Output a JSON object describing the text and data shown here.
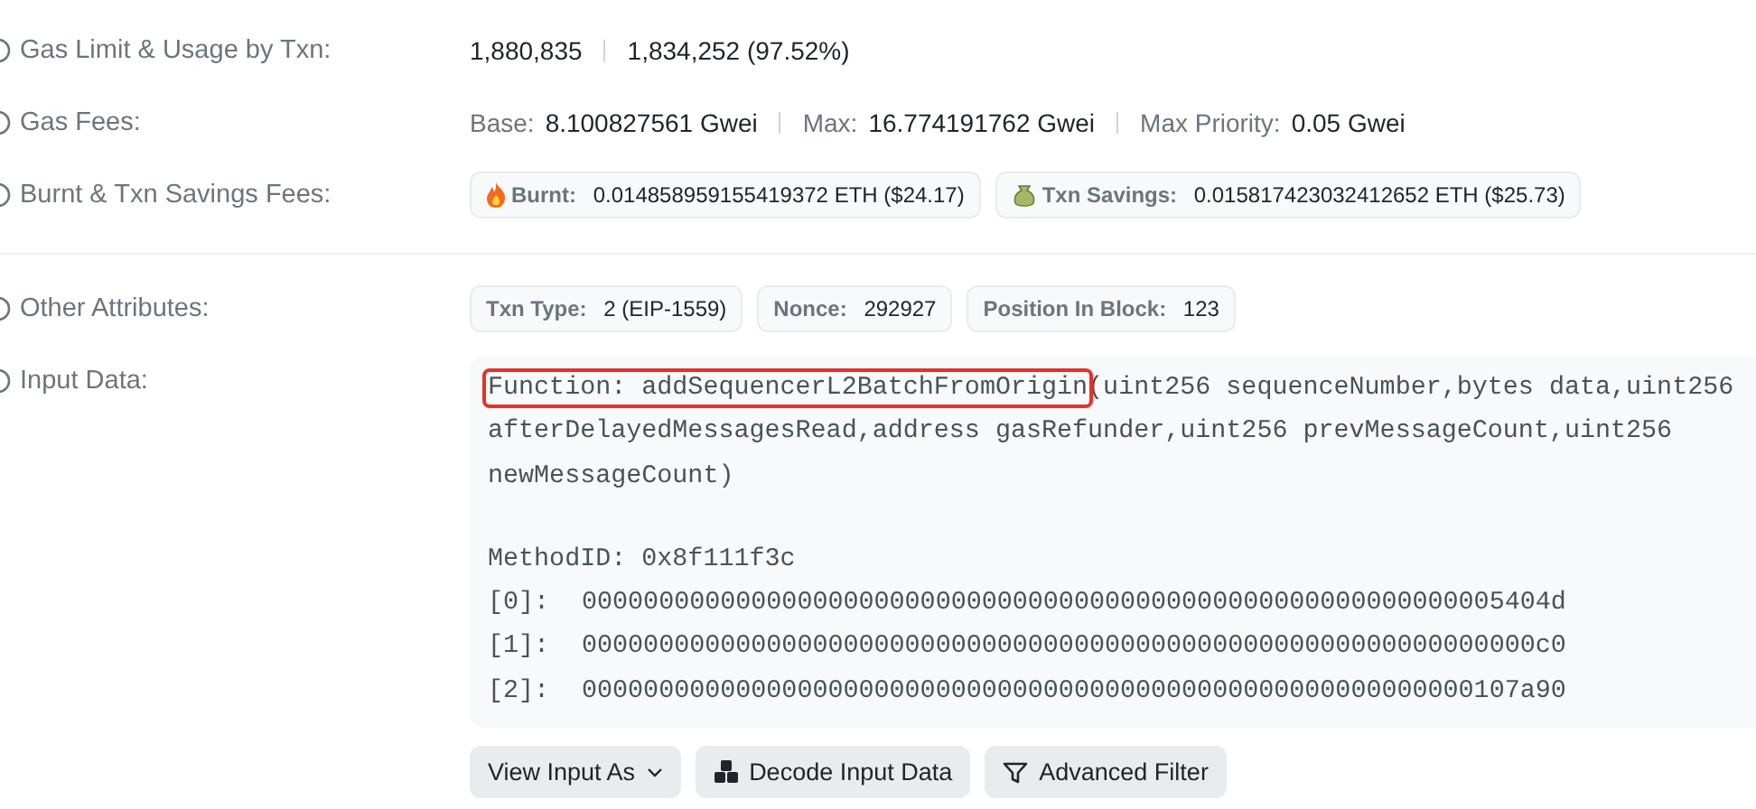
{
  "rows": [
    {
      "label": "Gas Limit & Usage by Txn:",
      "kind": "plain",
      "items": [
        {
          "value": "1,880,835"
        },
        {
          "value": "1,834,252 (97.52%)"
        }
      ]
    },
    {
      "label": "Gas Fees:",
      "kind": "labeled",
      "items": [
        {
          "name": "Base:",
          "value": "8.100827561 Gwei"
        },
        {
          "name": "Max:",
          "value": "16.774191762 Gwei"
        },
        {
          "name": "Max Priority:",
          "value": "0.05 Gwei"
        }
      ]
    },
    {
      "label": "Burnt & Txn Savings Fees:",
      "kind": "badges",
      "items": [
        {
          "name": "Burnt:",
          "value": "0.014858959155419372 ETH ($24.17)"
        },
        {
          "name": "Txn Savings:",
          "value": "0.015817423032412652 ETH ($25.73)"
        }
      ]
    },
    {
      "label": "Other Attributes:",
      "kind": "badges",
      "items": [
        {
          "name": "Txn Type:",
          "value": "2 (EIP-1559)"
        },
        {
          "name": "Nonce:",
          "value": "292927"
        },
        {
          "name": "Position In Block:",
          "value": "123"
        }
      ]
    }
  ],
  "input_data": {
    "label": "Input Data:",
    "highlighted": "Function: addSequencerL2BatchFromOrigin",
    "lines": [
      "(uint256 sequenceNumber,bytes data,uint256",
      "afterDelayedMessagesRead,address gasRefunder,uint256 prevMessageCount,uint256",
      "newMessageCount)"
    ],
    "method_id": "MethodID: 0x8f111f3c",
    "params": [
      {
        "index": "[0]:",
        "value": "000000000000000000000000000000000000000000000000000000000005404d"
      },
      {
        "index": "[1]:",
        "value": "00000000000000000000000000000000000000000000000000000000000000c0"
      },
      {
        "index": "[2]:",
        "value": "0000000000000000000000000000000000000000000000000000000000107a90"
      }
    ],
    "buttons": [
      "View Input As",
      "Decode Input Data",
      "Advanced Filter"
    ]
  }
}
